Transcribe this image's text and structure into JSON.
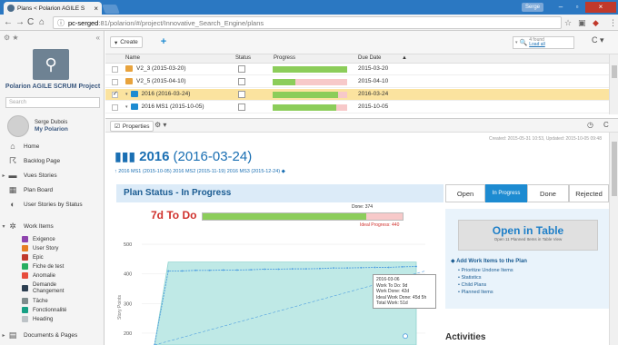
{
  "browser": {
    "tab_title": "Plans < Polarion AGILE S",
    "tab_close": "×",
    "user_chip": "Serge",
    "win_min": "–",
    "win_max": "▫",
    "win_close": "×",
    "url_host": "pc-serged",
    "url_path": ":81/polarion/#/project/Innovative_Search_Engine/plans",
    "back": "←",
    "forward": "→",
    "reload": "C",
    "home": "⌂",
    "info_icon": "ⓘ"
  },
  "sidebar": {
    "project_title": "Polarion AGILE SCRUM Project",
    "search_placeholder": "Search",
    "user_name": "Serge Dubois",
    "user_link": "My Polarion",
    "items": [
      {
        "label": "Home",
        "icon": "home-icon"
      },
      {
        "label": "Backlog Page",
        "icon": "backlog-icon"
      },
      {
        "label": "Vues Stories",
        "icon": "folder-icon"
      },
      {
        "label": "Plan Board",
        "icon": "board-icon"
      },
      {
        "label": "User Stories by Status",
        "icon": "pie-icon"
      },
      {
        "label": "Work Items",
        "icon": "workitems-icon"
      },
      {
        "label": "Documents & Pages",
        "icon": "documents-icon"
      }
    ],
    "work_items": [
      {
        "label": "Exigence",
        "color": "#8e44ad"
      },
      {
        "label": "User Story",
        "color": "#e67e22"
      },
      {
        "label": "Epic",
        "color": "#c0392b"
      },
      {
        "label": "Fiche de test",
        "color": "#27ae60"
      },
      {
        "label": "Anomalie",
        "color": "#e74c3c"
      },
      {
        "label": "Demande Changement",
        "color": "#2c3e50"
      },
      {
        "label": "Tâche",
        "color": "#7f8c8d"
      },
      {
        "label": "Fonctionnalité",
        "color": "#16a085"
      },
      {
        "label": "Heading",
        "color": "#bdc3c7"
      }
    ]
  },
  "plans_toolbar": {
    "create_label": "Create",
    "search_count": "4 found",
    "search_link": "Load all"
  },
  "grid": {
    "headers": {
      "name": "Name",
      "status": "Status",
      "progress": "Progress",
      "due": "Due Date"
    },
    "rows": [
      {
        "name": "V2_3 (2015-03-20)",
        "progress": 1.0,
        "due": "2015-03-20",
        "selected": false,
        "checked": false
      },
      {
        "name": "V2_5 (2015-04-10)",
        "progress": 0.3,
        "due": "2015-04-10",
        "selected": false,
        "checked": false
      },
      {
        "name": "2016 (2016-03-24)",
        "progress": 0.88,
        "due": "2016-03-24",
        "selected": true,
        "checked": true
      },
      {
        "name": "2016 MS1 (2015-10-05)",
        "progress": 0.85,
        "due": "2015-10-05",
        "selected": false,
        "checked": false
      }
    ]
  },
  "props": {
    "button_label": "Properties"
  },
  "doc": {
    "created": "Created: 2015-05-31 10:53, Updated: 2015-10-05 09:48",
    "plan_name": "2016",
    "plan_date": "(2016-03-24)",
    "plan_links": "2016 MS1 (2015-10-05)  2016 MS2 (2015-11-19)  2016 MS3 (2015-12-24)",
    "status_title": "Plan Status - In Progress",
    "todo": "7d To Do",
    "done_label": "Done: 374",
    "ideal_label": "Ideal Progress: 440",
    "progress_done": 0.82
  },
  "chart_data": {
    "type": "line",
    "ylabel": "Story Points",
    "yticks": [
      200,
      300,
      400,
      500
    ],
    "ylim": [
      160,
      540
    ],
    "series": [
      {
        "values": [
          160,
          410,
          410,
          412,
          412,
          413,
          413,
          414,
          416,
          416,
          417,
          417,
          418,
          420,
          420,
          421,
          422,
          422,
          424,
          425
        ]
      },
      {
        "values": [
          160,
          440,
          440,
          440,
          440,
          440,
          440,
          440,
          440,
          440,
          440,
          440,
          440,
          440,
          440,
          440,
          440,
          440,
          440,
          440
        ]
      }
    ]
  },
  "tooltip": {
    "date": "2016-03-06",
    "todo": "Work To Do: 9d",
    "done": "Work Done: 42d",
    "ideal": "Ideal Work Done: 45d 5h",
    "total": "Total Work: 51d"
  },
  "status_tabs": [
    {
      "label": "Open",
      "active": false
    },
    {
      "label": "In Progress",
      "active": true
    },
    {
      "label": "Done",
      "active": false
    },
    {
      "label": "Rejected",
      "active": false
    }
  ],
  "right_panel": {
    "open_table": "Open in Table",
    "open_table_sub": "Open 11 Planned Items in Table View",
    "add_work_items": "Add Work Items to the Plan",
    "links": [
      "Prioritize Undone Items",
      "Statistics",
      "Child Plans",
      "Planned Items"
    ]
  },
  "activities": "Activities"
}
